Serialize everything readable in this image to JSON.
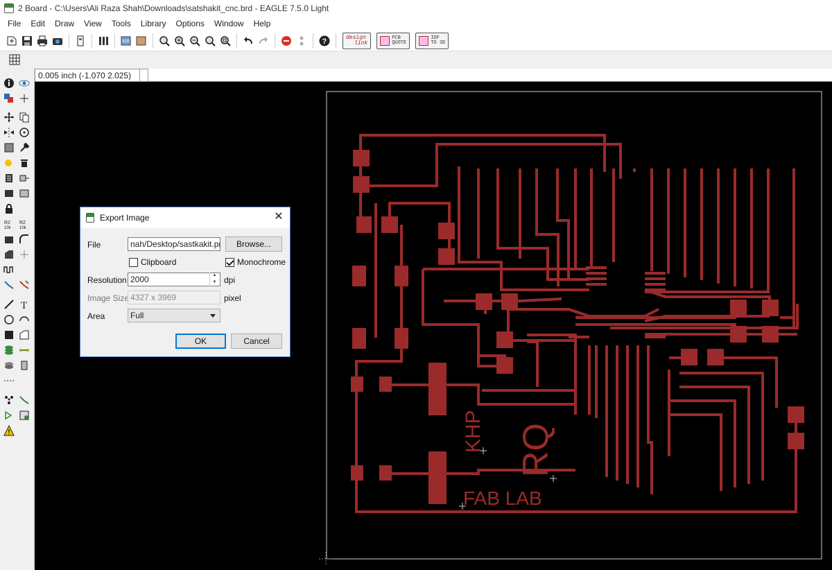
{
  "window": {
    "title": "2 Board - C:\\Users\\Ali Raza Shah\\Downloads\\satshakit_cnc.brd - EAGLE 7.5.0 Light"
  },
  "menu": [
    "File",
    "Edit",
    "Draw",
    "View",
    "Tools",
    "Library",
    "Options",
    "Window",
    "Help"
  ],
  "toolbar": {
    "design_link": [
      "design",
      "link"
    ],
    "pcb_quote": [
      "PCB",
      "QUOTE"
    ],
    "idf_to_3d": [
      "IDF",
      "TO 3D"
    ]
  },
  "coord": {
    "text": "0.005 inch (-1.070 2.025)"
  },
  "board": {
    "trace_color": "#9b2a2a",
    "texts": {
      "khp": "KHP",
      "rq": "RQ",
      "fab_lab": "FAB LAB"
    }
  },
  "dialog": {
    "title": "Export Image",
    "file_label": "File",
    "file_value": "nah/Desktop/sastkakit.png",
    "browse_label": "Browse...",
    "clipboard_label": "Clipboard",
    "clipboard_checked": false,
    "monochrome_label": "Monochrome",
    "monochrome_checked": true,
    "resolution_label": "Resolution",
    "resolution_value": "2000",
    "dpi_label": "dpi",
    "image_size_label": "Image Size",
    "image_size_value": "4327 x 3969",
    "pixel_label": "pixel",
    "area_label": "Area",
    "area_value": "Full",
    "ok_label": "OK",
    "cancel_label": "Cancel"
  }
}
